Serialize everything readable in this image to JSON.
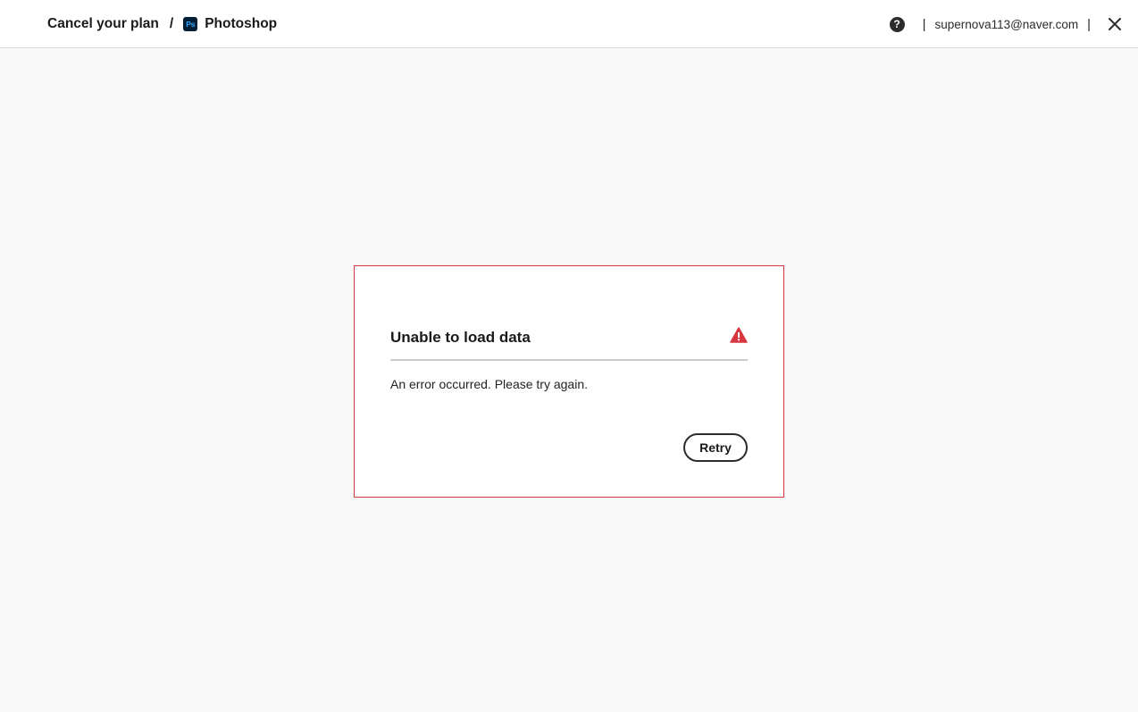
{
  "header": {
    "breadcrumb": {
      "parent": "Cancel your plan",
      "separator": "/",
      "product_icon": "Ps",
      "product": "Photoshop"
    },
    "help_icon": "?",
    "pipe": "|",
    "email": "supernova113@naver.com",
    "close_icon": "close-icon"
  },
  "error_card": {
    "title": "Unable to load data",
    "message": "An error occurred. Please try again.",
    "retry_label": "Retry",
    "alert_icon": "alert-triangle-icon"
  },
  "colors": {
    "error": "#d7373f",
    "photoshop_bg": "#001e36",
    "photoshop_fg": "#31a8ff",
    "page_bg": "#f8f8f8"
  }
}
